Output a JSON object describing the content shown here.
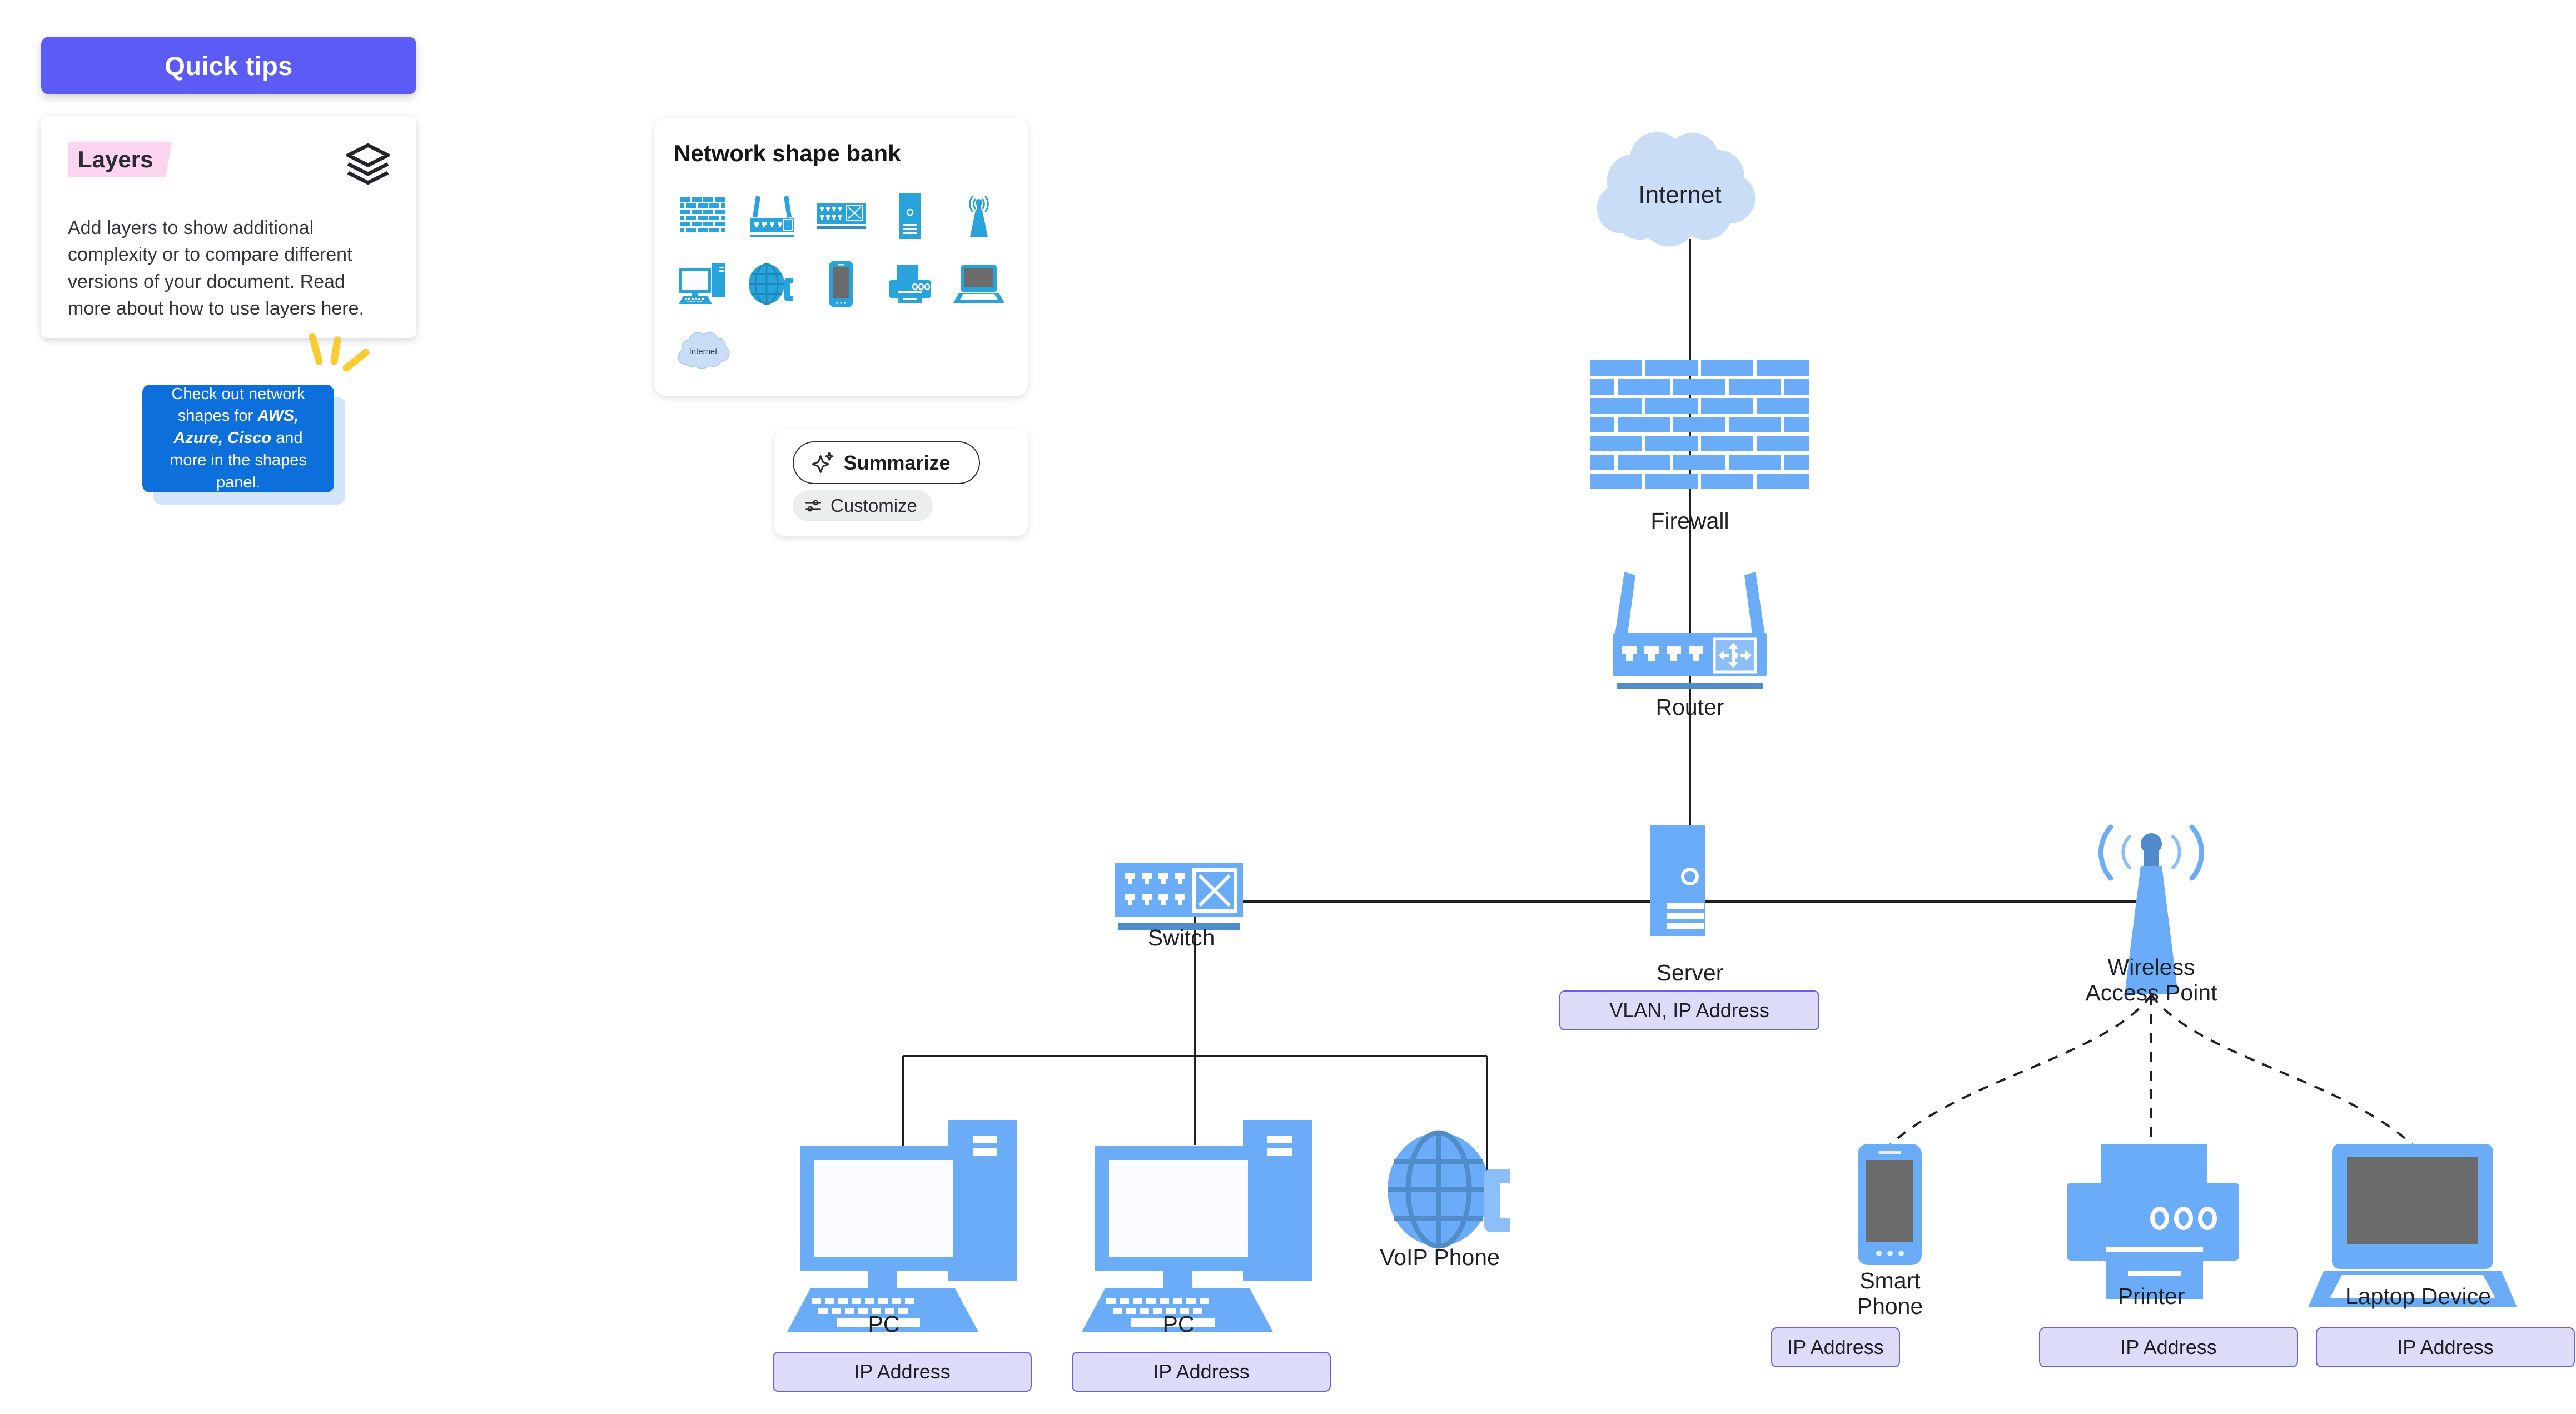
{
  "quick_tips": {
    "header_label": "Quick tips",
    "tag_label": "Layers",
    "layers_icon": "layers-icon",
    "body_text": "Add layers to show additional complexity or to compare different versions of your document. Read more about how to use layers here."
  },
  "blue_note": {
    "line1": "Check out network",
    "line2_pre": "shapes for ",
    "line2_bold": "AWS, Azure,",
    "line3_bold": "Cisco",
    "line3_post": " and more in the",
    "line4": "shapes panel."
  },
  "shape_bank": {
    "title": "Network shape bank",
    "cloud_label": "Internet",
    "shapes": [
      {
        "name": "firewall-shape",
        "icon": "firewall-icon"
      },
      {
        "name": "router-shape",
        "icon": "router-icon"
      },
      {
        "name": "switch-shape",
        "icon": "switch-icon"
      },
      {
        "name": "server-shape",
        "icon": "server-icon"
      },
      {
        "name": "antenna-shape",
        "icon": "antenna-icon"
      },
      {
        "name": "pc-shape",
        "icon": "pc-icon"
      },
      {
        "name": "voip-phone-shape",
        "icon": "globe-phone-icon"
      },
      {
        "name": "smartphone-shape",
        "icon": "smartphone-icon"
      },
      {
        "name": "printer-shape",
        "icon": "printer-icon"
      },
      {
        "name": "laptop-shape",
        "icon": "laptop-icon"
      },
      {
        "name": "internet-cloud-shape",
        "icon": "cloud-icon"
      }
    ]
  },
  "summarize_widget": {
    "summarize_label": "Summarize",
    "summarize_icon": "sparkle-icon",
    "customize_label": "Customize",
    "customize_icon": "sliders-icon"
  },
  "diagram": {
    "nodes": [
      {
        "id": "internet",
        "label": "Internet",
        "icon": "cloud-icon"
      },
      {
        "id": "firewall",
        "label": "Firewall",
        "icon": "brick-wall-icon"
      },
      {
        "id": "router",
        "label": "Router",
        "icon": "router-icon"
      },
      {
        "id": "switch",
        "label": "Switch",
        "icon": "switch-icon"
      },
      {
        "id": "server",
        "label": "Server",
        "icon": "server-tower-icon"
      },
      {
        "id": "wap",
        "label": "Wireless\nAccess Point",
        "icon": "antenna-icon"
      },
      {
        "id": "pc1",
        "label": "PC",
        "icon": "desktop-pc-icon"
      },
      {
        "id": "pc2",
        "label": "PC",
        "icon": "desktop-pc-icon"
      },
      {
        "id": "voip",
        "label": "VoIP Phone",
        "icon": "globe-phone-icon"
      },
      {
        "id": "smartphone",
        "label": "Smart\nPhone",
        "icon": "smartphone-icon"
      },
      {
        "id": "printer",
        "label": "Printer",
        "icon": "printer-icon"
      },
      {
        "id": "laptop",
        "label": "Laptop Device",
        "icon": "laptop-icon"
      }
    ],
    "badges": [
      {
        "id": "server-badge",
        "text": "VLAN, IP Address"
      },
      {
        "id": "pc1-badge",
        "text": "IP Address"
      },
      {
        "id": "pc2-badge",
        "text": "IP Address"
      },
      {
        "id": "smartphone-badge",
        "text": "IP Address"
      },
      {
        "id": "printer-badge",
        "text": "IP Address"
      },
      {
        "id": "laptop-badge",
        "text": "IP Address"
      }
    ]
  },
  "colors": {
    "accent_purple": "#5b5bf5",
    "note_blue": "#0d6fdb",
    "tag_pink": "#fbd4f0",
    "sparkle_yellow": "#facc32",
    "device_blue": "#6aacf7",
    "bank_icon_blue": "#29a3dc",
    "cloud_fill": "#c9ddf7",
    "badge_fill": "#dcdcf8",
    "badge_border": "#6c5ce7",
    "line_color": "#1f1f24"
  }
}
